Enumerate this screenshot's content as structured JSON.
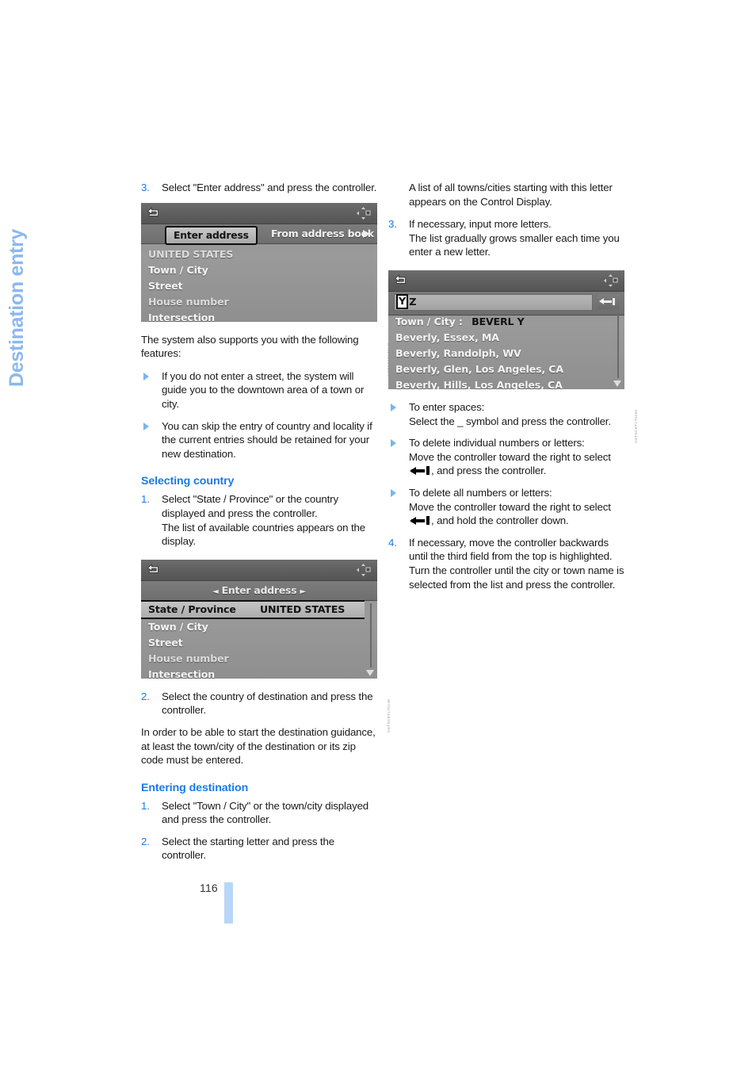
{
  "chapter": {
    "title": "Destination entry"
  },
  "page": {
    "number": "116"
  },
  "left_column": {
    "step3": {
      "num": "3.",
      "text": "Select \"Enter address\" and press the controller."
    },
    "figure1": {
      "name": "enter-address-screen",
      "back_icon": "back-arrow-icon",
      "status_icon": "navigation-compass-icon",
      "tab_selected": "Enter address",
      "tab_other": "From address book",
      "tab_arrow": "chevron-right-icon",
      "rows": [
        "UNITED STATES",
        "Town / City",
        "Street",
        "House number",
        "Intersection"
      ],
      "caption": "VGTSCET170146"
    },
    "intro": "The system also supports you with the following features:",
    "bullets": [
      "If you do not enter a street, the system will guide you to the downtown area of a town or city.",
      "You can skip the entry of country and locality if the current entries should be retained for your new destination."
    ],
    "heading_country": "Selecting country",
    "country_step1": {
      "num": "1.",
      "text": "Select \"State / Province\" or the country displayed and press the controller.",
      "sub": "The list of available countries appears on the display."
    },
    "figure2": {
      "name": "state-province-screen",
      "back_icon": "back-arrow-icon",
      "status_icon": "navigation-compass-icon",
      "title": "Enter address",
      "title_left_arrow": "chevron-left-icon",
      "title_right_arrow": "chevron-right-icon",
      "highlight_label": "State / Province",
      "highlight_value": "UNITED STATES",
      "rows": [
        "Town / City",
        "Street",
        "House number",
        "Intersection"
      ],
      "scroll_down_icon": "scroll-down-arrow-icon",
      "caption": "VGTSCET170148"
    },
    "country_step2": {
      "num": "2.",
      "text": "Select the country of destination and press the controller."
    },
    "note": "In order to be able to start the destination guidance, at least the town/city of the destination or its zip code must be entered.",
    "heading_destination": "Entering destination",
    "dest_step1": {
      "num": "1.",
      "text": "Select \"Town / City\" or the town/city displayed and press the controller."
    },
    "dest_step2": {
      "num": "2.",
      "text": "Select the starting letter and press the controller."
    }
  },
  "right_column": {
    "lead": "A list of all towns/cities starting with this letter appears on the Control Display.",
    "step3": {
      "num": "3.",
      "text": "If necessary, input more letters.",
      "sub": "The list gradually grows smaller each time you enter a new letter."
    },
    "figure3": {
      "name": "town-city-list-screen",
      "back_icon": "back-arrow-icon",
      "status_icon": "navigation-compass-icon",
      "selected_letter": "Y",
      "next_letter": "Z",
      "backspace_icon": "backspace-arrow-icon",
      "result_label": "Town / City :",
      "result_value": "BEVERL Y",
      "rows": [
        "Beverly, Essex, MA",
        "Beverly, Randolph, WV",
        "Beverly, Glen, Los Angeles, CA",
        "Beverly, Hills, Los Angeles, CA"
      ],
      "scroll_down_icon": "scroll-down-arrow-icon",
      "caption": "VGTSCET170150"
    },
    "bullets": [
      {
        "title": "To enter spaces:",
        "body_before": "Select the _ symbol and press the controller.",
        "glyph": false,
        "body_after": ""
      },
      {
        "title": "To delete individual numbers or letters:",
        "body_before": "Move the controller toward the right to select",
        "glyph": true,
        "body_after": ", and press the controller."
      },
      {
        "title": "To delete all numbers or letters:",
        "body_before": "Move the controller toward the right to select",
        "glyph": true,
        "body_after": ", and hold the controller down."
      }
    ],
    "step4": {
      "num": "4.",
      "text": "If necessary, move the controller backwards until the third field from the top is highlighted. Turn the controller until the city or town name is selected from the list and press the controller."
    }
  },
  "colors": {
    "accent_blue": "#1a7ae8",
    "chapter_blue": "#8cb8ef",
    "page_marker": "#b8d6f7",
    "screen_gray": "#8f8f8f"
  }
}
